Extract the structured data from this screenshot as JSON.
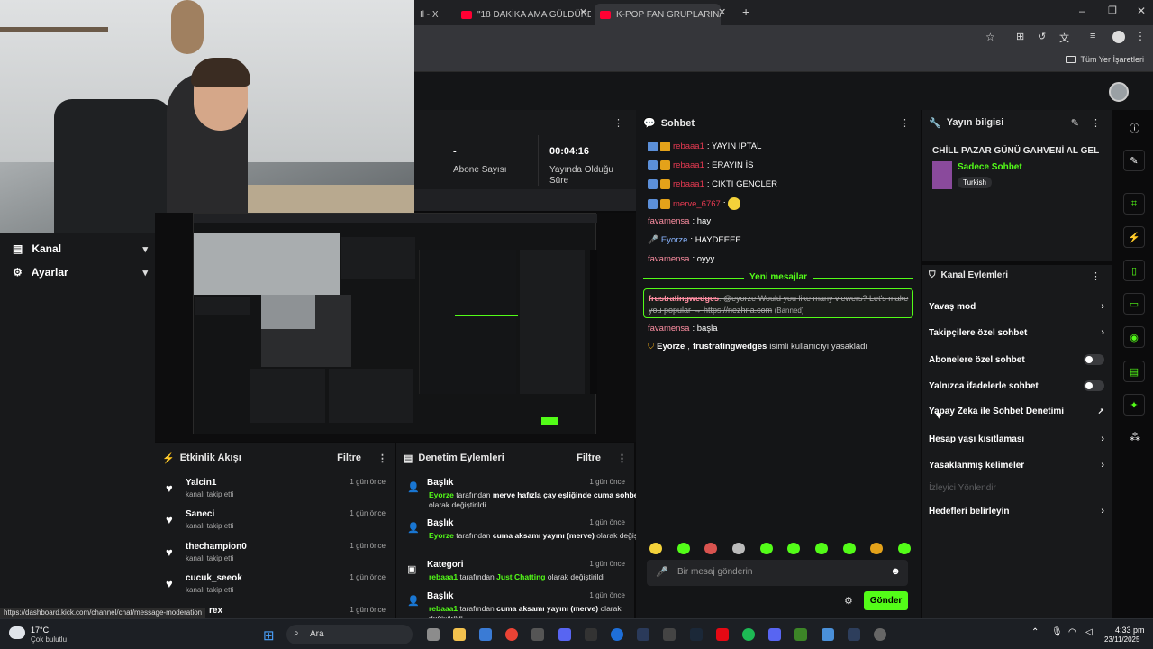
{
  "tabs": [
    {
      "label": "Il - X"
    },
    {
      "label": "\"18 DAKİKA AMA GÜLDÜREN V"
    },
    {
      "label": "K-POP FAN GRUPLARINA SIZD"
    }
  ],
  "bookmarks": {
    "label": "Tüm Yer İşaretleri"
  },
  "sidebar": {
    "items": [
      {
        "label": "Kanal"
      },
      {
        "label": "Ayarlar"
      }
    ]
  },
  "stats": {
    "subs_value": "-",
    "subs_label": "Abone Sayısı",
    "uptime_value": "00:04:16",
    "uptime_label": "Yayında Olduğu Süre"
  },
  "activity": {
    "title": "Etkinlik Akışı",
    "filter": "Filtre",
    "items": [
      {
        "name": "Yalcin1",
        "sub": "kanalı takip etti",
        "time": "1 gün önce"
      },
      {
        "name": "Saneci",
        "sub": "kanalı takip etti",
        "time": "1 gün önce"
      },
      {
        "name": "thechampion0",
        "sub": "kanalı takip etti",
        "time": "1 gün önce"
      },
      {
        "name": "cucuk_seeok",
        "sub": "kanalı takip etti",
        "time": "1 gün önce"
      },
      {
        "name": "rex",
        "sub": "",
        "time": "1 gün önce"
      }
    ]
  },
  "moderation": {
    "title": "Denetim Eylemleri",
    "filter": "Filtre",
    "items": [
      {
        "title": "Başlık",
        "time": "1 gün önce",
        "user": "Eyorze",
        "mid": " tarafından ",
        "val": "merve hafızla çay eşliğinde cuma sohbetleri",
        "tail": " olarak değiştirildi"
      },
      {
        "title": "Başlık",
        "time": "1 gün önce",
        "user": "Eyorze",
        "mid": " tarafından ",
        "val": "cuma aksamı yayını (merve)",
        "tail": " olarak değiştirildi"
      },
      {
        "title": "Kategori",
        "time": "1 gün önce",
        "user": "rebaaa1",
        "mid": " tarafından ",
        "val": "Just Chatting",
        "tail": " olarak değiştirildi"
      },
      {
        "title": "Başlık",
        "time": "1 gün önce",
        "user": "rebaaa1",
        "mid": " tarafından ",
        "val": "cuma aksamı yayını (merve)",
        "tail": " olarak değiştirildi"
      }
    ]
  },
  "chat": {
    "title": "Sohbet",
    "messages": [
      {
        "user": "rebaaa1",
        "text": ": YAYIN İPTAL"
      },
      {
        "user": "rebaaa1",
        "text": ": ERAYIN İS"
      },
      {
        "user": "rebaaa1",
        "text": ": CIKTI GENCLER"
      },
      {
        "user": "merve_6767",
        "text": ": "
      },
      {
        "user": "favamensa",
        "text": ": hay"
      },
      {
        "user": "Eyorze",
        "text": ": HAYDEEEE"
      },
      {
        "user": "favamensa",
        "text": ": oyyy"
      }
    ],
    "new_messages": "Yeni mesajlar",
    "flagged": {
      "user": "frustratingwedges",
      "text": ": @eyorze Would you like many viewers? Let's make you popular → https://nezhna.com",
      "tag": "(Banned)"
    },
    "after": {
      "user": "favamensa",
      "text": ": başla"
    },
    "ban_notice": {
      "actor": "Eyorze",
      "target": "frustratingwedges",
      "text": " isimli kullanıcıyı yasakladı"
    },
    "placeholder": "Bir mesaj gönderin",
    "send": "Gönder"
  },
  "stream_info": {
    "title": "Yayın bilgisi",
    "stream_title": "CHİLL PAZAR GÜNÜ GAHVENİ AL GEL",
    "category": "Sadece Sohbet",
    "language": "Turkish"
  },
  "channel_actions": {
    "title": "Kanal Eylemleri",
    "items": [
      {
        "label": "Yavaş mod",
        "kind": "chevron"
      },
      {
        "label": "Takipçilere özel sohbet",
        "kind": "chevron"
      },
      {
        "label": "Abonelere özel sohbet",
        "kind": "toggle"
      },
      {
        "label": "Yalnızca ifadelerle sohbet",
        "kind": "toggle"
      },
      {
        "label": "Yapay Zeka ile Sohbet Denetimi",
        "kind": "external"
      },
      {
        "label": "Hesap yaşı kısıtlaması",
        "kind": "chevron"
      },
      {
        "label": "Yasaklanmış kelimeler",
        "kind": "chevron"
      },
      {
        "label": "İzleyici Yönlendir",
        "kind": "disabled"
      },
      {
        "label": "Hedefleri belirleyin",
        "kind": "chevron"
      }
    ]
  },
  "tooltip": "https://dashboard.kick.com/channel/chat/message-moderation",
  "taskbar": {
    "weather_temp": "17°C",
    "weather_desc": "Çok bulutlu",
    "search": "Ara",
    "time": "4:33 pm",
    "date": "23/11/2025"
  },
  "colors": {
    "accent": "#53fc18",
    "username_red": "#e83a52",
    "username_pink": "#ff8fa3"
  }
}
